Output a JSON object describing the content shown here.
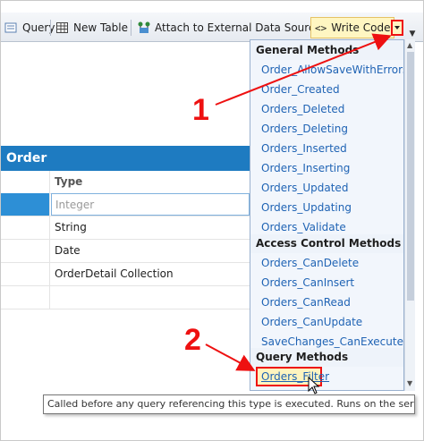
{
  "toolbar": {
    "query_label": "Query",
    "new_table_label": "New Table",
    "attach_label": "Attach to External Data Source...",
    "write_code_icon": "<>",
    "write_code_label": "Write Code"
  },
  "entity": {
    "title": "Order",
    "type_header": "Type",
    "rows": [
      "Integer",
      "String",
      "Date",
      "OrderDetail Collection"
    ]
  },
  "menu": {
    "general_header": "General Methods",
    "general_items": [
      "Order_AllowSaveWithErrors",
      "Order_Created",
      "Orders_Deleted",
      "Orders_Deleting",
      "Orders_Inserted",
      "Orders_Inserting",
      "Orders_Updated",
      "Orders_Updating",
      "Orders_Validate"
    ],
    "access_header": "Access Control Methods",
    "access_items": [
      "Orders_CanDelete",
      "Orders_CanInsert",
      "Orders_CanRead",
      "Orders_CanUpdate",
      "SaveChanges_CanExecute"
    ],
    "query_header": "Query Methods",
    "query_items": [
      "Orders_Filter"
    ]
  },
  "tooltip": "Called before any query referencing this type is executed.  Runs on the server.",
  "annotations": {
    "step1": "1",
    "step2": "2"
  },
  "colors": {
    "accent": "#1e7bc1",
    "annotation": "#ee1111",
    "link": "#1f63b4"
  }
}
